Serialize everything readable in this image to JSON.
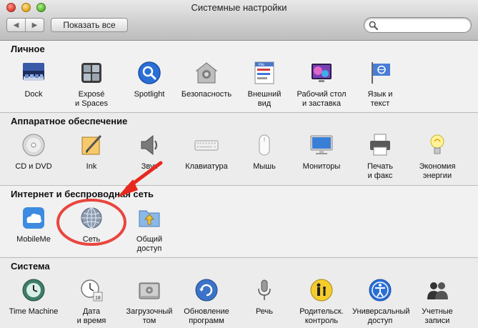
{
  "window": {
    "title": "Системные настройки"
  },
  "toolbar": {
    "back_glyph": "◀",
    "forward_glyph": "▶",
    "show_all_label": "Показать все",
    "search_placeholder": ""
  },
  "sections": {
    "personal": {
      "title": "Личное",
      "items": [
        {
          "label": "Dock",
          "icon": "dock-icon"
        },
        {
          "label": "Exposé\nи Spaces",
          "icon": "expose-icon"
        },
        {
          "label": "Spotlight",
          "icon": "spotlight-icon"
        },
        {
          "label": "Безопасность",
          "icon": "security-icon"
        },
        {
          "label": "Внешний\nвид",
          "icon": "appearance-icon"
        },
        {
          "label": "Рабочий стол\nи заставка",
          "icon": "desktop-icon"
        },
        {
          "label": "Язык и\nтекст",
          "icon": "language-icon"
        }
      ]
    },
    "hardware": {
      "title": "Аппаратное обеспечение",
      "items": [
        {
          "label": "CD и DVD",
          "icon": "cd-dvd-icon"
        },
        {
          "label": "Ink",
          "icon": "ink-icon"
        },
        {
          "label": "Звук",
          "icon": "sound-icon"
        },
        {
          "label": "Клавиатура",
          "icon": "keyboard-icon"
        },
        {
          "label": "Мышь",
          "icon": "mouse-icon"
        },
        {
          "label": "Мониторы",
          "icon": "displays-icon"
        },
        {
          "label": "Печать\nи факс",
          "icon": "print-fax-icon"
        },
        {
          "label": "Экономия\nэнергии",
          "icon": "energy-saver-icon"
        }
      ]
    },
    "internet": {
      "title": "Интернет и беспроводная сеть",
      "items": [
        {
          "label": "MobileMe",
          "icon": "mobileme-icon"
        },
        {
          "label": "Сеть",
          "icon": "network-icon"
        },
        {
          "label": "Общий\nдоступ",
          "icon": "sharing-icon"
        }
      ]
    },
    "system": {
      "title": "Система",
      "items": [
        {
          "label": "Time Machine",
          "icon": "time-machine-icon"
        },
        {
          "label": "Дата\nи время",
          "icon": "date-time-icon"
        },
        {
          "label": "Загрузочный\nтом",
          "icon": "startup-disk-icon"
        },
        {
          "label": "Обновление\nпрограмм",
          "icon": "software-update-icon"
        },
        {
          "label": "Речь",
          "icon": "speech-icon"
        },
        {
          "label": "Родительск.\nконтроль",
          "icon": "parental-controls-icon"
        },
        {
          "label": "Универсальный\nдоступ",
          "icon": "universal-access-icon"
        },
        {
          "label": "Учетные\nзаписи",
          "icon": "accounts-icon"
        }
      ]
    }
  },
  "annotation": {
    "color": "#e8281e"
  }
}
